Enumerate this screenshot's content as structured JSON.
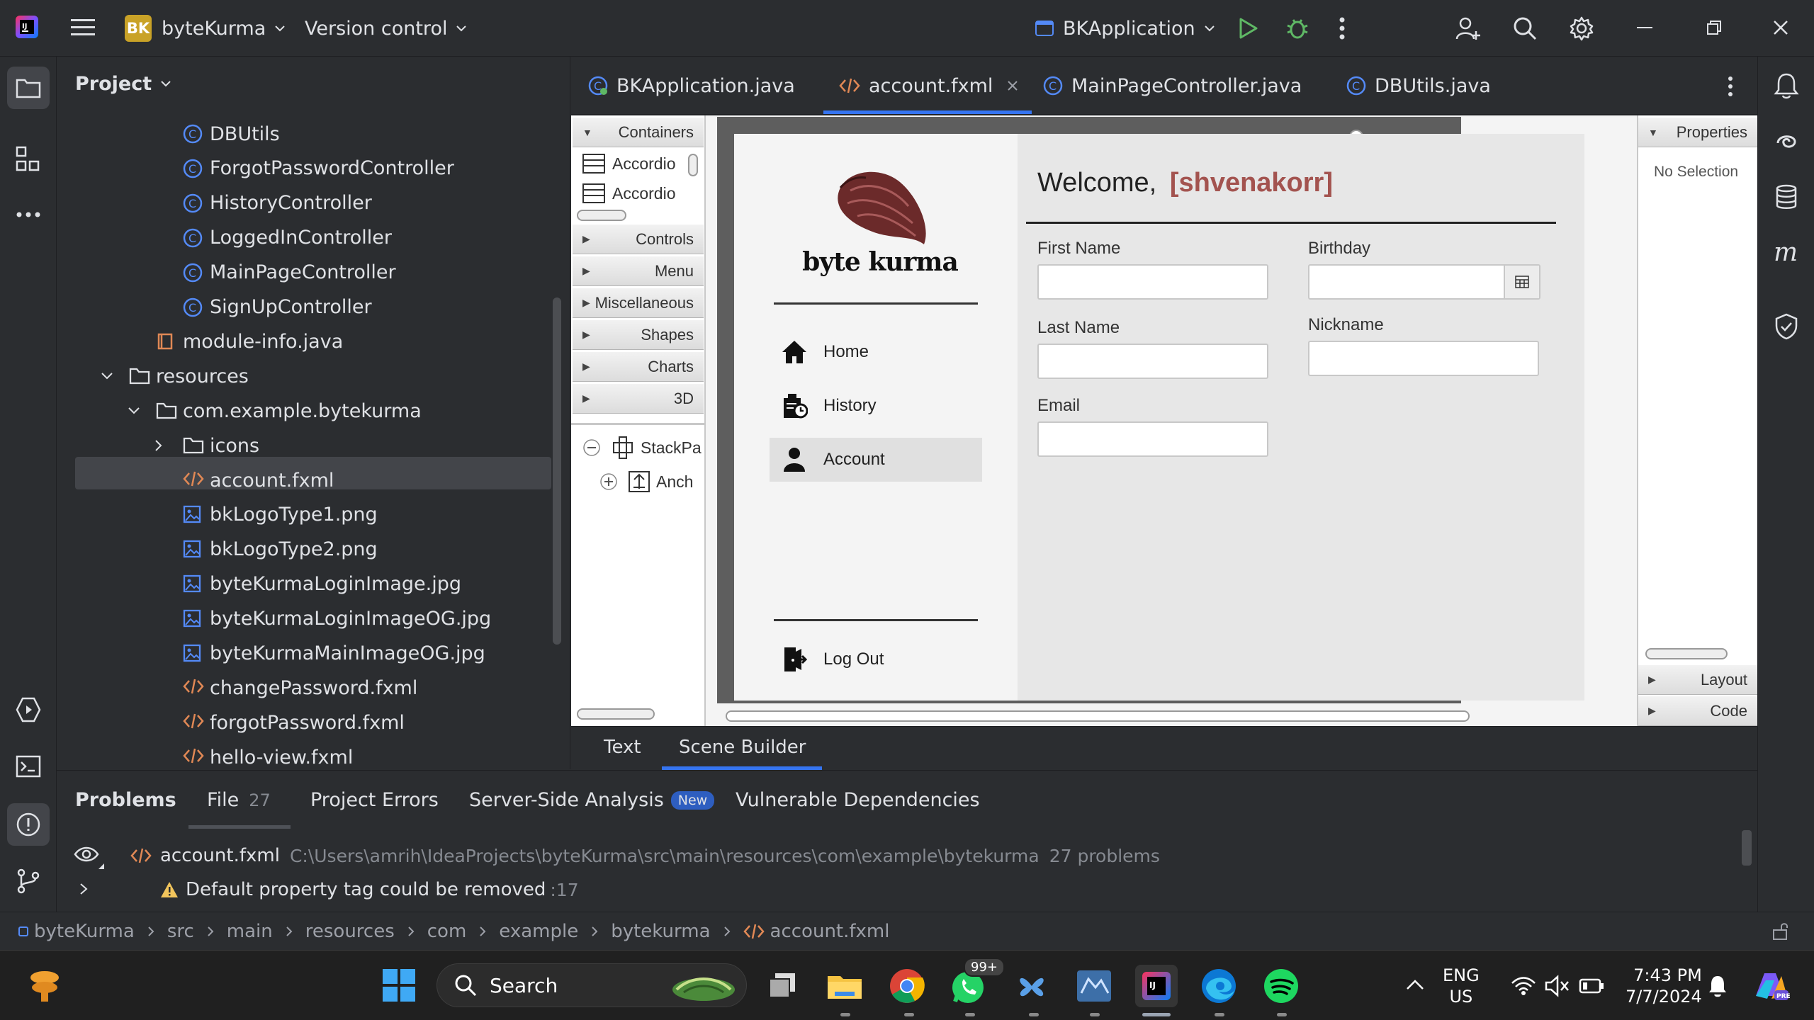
{
  "titlebar": {
    "project_badge": "BK",
    "project_name": "byteKurma",
    "vcs": "Version control",
    "run_config": "BKApplication"
  },
  "project_panel": {
    "title": "Project",
    "tree": [
      {
        "label": "DBUtils",
        "icon": "class-icon"
      },
      {
        "label": "ForgotPasswordController",
        "icon": "class-icon"
      },
      {
        "label": "HistoryController",
        "icon": "class-icon"
      },
      {
        "label": "LoggedInController",
        "icon": "class-icon"
      },
      {
        "label": "MainPageController",
        "icon": "class-icon"
      },
      {
        "label": "SignUpController",
        "icon": "class-icon"
      },
      {
        "label": "module-info.java",
        "icon": "module-icon"
      },
      {
        "label": "resources",
        "icon": "folder-icon"
      },
      {
        "label": "com.example.bytekurma",
        "icon": "folder-icon"
      },
      {
        "label": "icons",
        "icon": "folder-icon"
      },
      {
        "label": "account.fxml",
        "icon": "fxml-icon"
      },
      {
        "label": "bkLogoType1.png",
        "icon": "image-icon"
      },
      {
        "label": "bkLogoType2.png",
        "icon": "image-icon"
      },
      {
        "label": "byteKurmaLoginImage.jpg",
        "icon": "image-icon"
      },
      {
        "label": "byteKurmaLoginImageOG.jpg",
        "icon": "image-icon"
      },
      {
        "label": "byteKurmaMainImageOG.jpg",
        "icon": "image-icon"
      },
      {
        "label": "changePassword.fxml",
        "icon": "fxml-icon"
      },
      {
        "label": "forgotPassword.fxml",
        "icon": "fxml-icon"
      },
      {
        "label": "hello-view.fxml",
        "icon": "fxml-icon"
      }
    ]
  },
  "editor_tabs": [
    {
      "label": "BKApplication.java"
    },
    {
      "label": "account.fxml"
    },
    {
      "label": "MainPageController.java"
    },
    {
      "label": "DBUtils.java"
    }
  ],
  "library": {
    "sections": [
      "Containers",
      "Controls",
      "Menu",
      "Miscellaneous",
      "Shapes",
      "Charts",
      "3D"
    ],
    "containers_items": [
      "Accordio",
      "Accordio"
    ],
    "hierarchy": [
      "StackPa",
      "Anch"
    ]
  },
  "inspector": {
    "properties": "Properties",
    "no_selection": "No Selection",
    "layout": "Layout",
    "code": "Code"
  },
  "app_preview": {
    "logo_text": "byte kurma",
    "nav": [
      {
        "label": "Home",
        "icon": "home-icon"
      },
      {
        "label": "History",
        "icon": "history-icon"
      },
      {
        "label": "Account",
        "icon": "user-icon"
      }
    ],
    "logout": "Log Out",
    "welcome": "Welcome,",
    "username": "[shvenakorr]",
    "fields": {
      "first_name": "First Name",
      "last_name": "Last Name",
      "email": "Email",
      "birthday": "Birthday",
      "nickname": "Nickname"
    }
  },
  "bottom_tabs": [
    "Text",
    "Scene Builder"
  ],
  "problems": {
    "tabs": [
      {
        "label": "Problems"
      },
      {
        "label": "File",
        "count": "27"
      },
      {
        "label": "Project Errors"
      },
      {
        "label": "Server-Side Analysis",
        "badge": "New"
      },
      {
        "label": "Vulnerable Dependencies"
      }
    ],
    "file": "account.fxml",
    "path": "C:\\Users\\amrih\\IdeaProjects\\byteKurma\\src\\main\\resources\\com\\example\\bytekurma",
    "count": "27 problems",
    "warning": "Default property tag could be removed",
    "line": ":17"
  },
  "breadcrumb": [
    "byteKurma",
    "src",
    "main",
    "resources",
    "com",
    "example",
    "bytekurma",
    "account.fxml"
  ],
  "taskbar": {
    "search": "Search",
    "whatsapp_badge": "99+",
    "lang": "ENG",
    "region": "US",
    "time": "7:43 PM",
    "date": "7/7/2024"
  },
  "colors": {
    "accent": "#3574f0",
    "username": "#a3534f",
    "run_green": "#5fb865"
  }
}
